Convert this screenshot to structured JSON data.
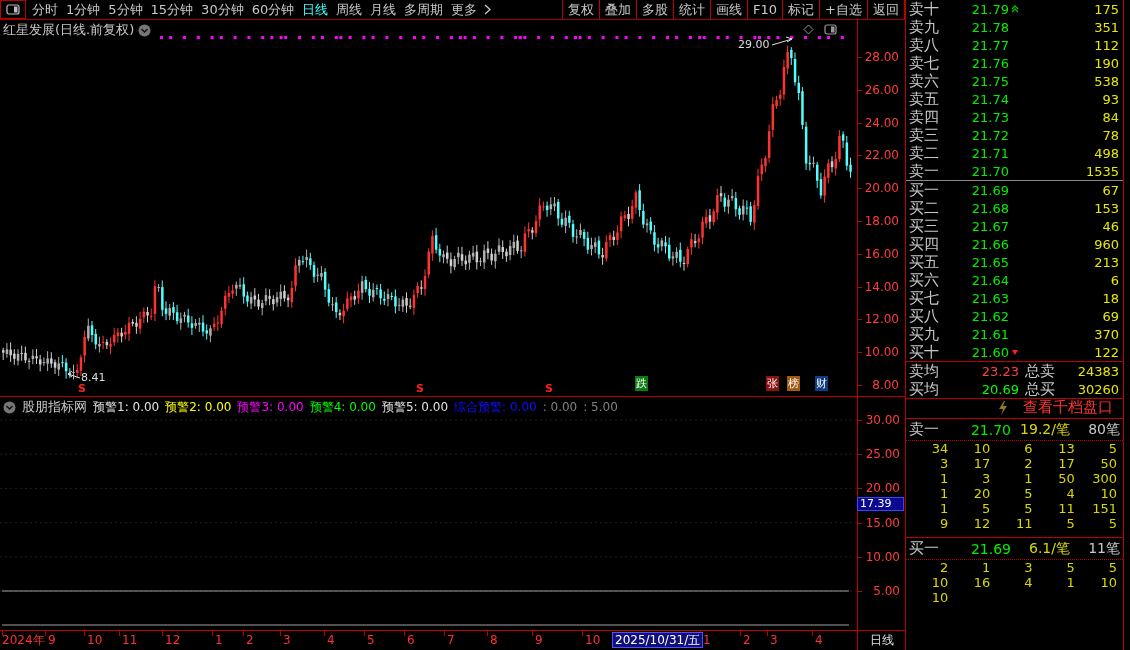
{
  "toolbar": {
    "periods": [
      {
        "label": "分时",
        "selected": false
      },
      {
        "label": "1分钟",
        "selected": false
      },
      {
        "label": "5分钟",
        "selected": false
      },
      {
        "label": "15分钟",
        "selected": false
      },
      {
        "label": "30分钟",
        "selected": false
      },
      {
        "label": "60分钟",
        "selected": false
      },
      {
        "label": "日线",
        "selected": true
      },
      {
        "label": "周线",
        "selected": false
      },
      {
        "label": "月线",
        "selected": false
      },
      {
        "label": "多周期",
        "selected": false
      },
      {
        "label": "更多",
        "selected": false
      }
    ],
    "buttons": [
      "复权",
      "叠加",
      "多股",
      "统计",
      "画线",
      "F10",
      "标记",
      "+自选",
      "返回"
    ]
  },
  "chart": {
    "title": "红星发展(日线.前复权)",
    "y_ticks": [
      "28.00",
      "26.00",
      "24.00",
      "22.00",
      "20.00",
      "18.00",
      "16.00",
      "14.00",
      "12.00",
      "10.00",
      "8.00"
    ],
    "high_label": "29.00",
    "low_label": "8.41",
    "signals": [
      {
        "text": "S"
      },
      {
        "text": "S"
      },
      {
        "text": "S"
      }
    ],
    "badges": [
      {
        "text": "跌",
        "color": "#0c7a10"
      },
      {
        "text": "张",
        "color": "#8c1212"
      },
      {
        "text": "榜",
        "color": "#a05a12"
      },
      {
        "text": "财",
        "color": "#123c80"
      }
    ]
  },
  "indicator": {
    "name": "股朋指标网",
    "values": [
      {
        "label": "预警1: 0.00",
        "color": "#e0e0e0"
      },
      {
        "label": "预警2: 0.00",
        "color": "#ffff00"
      },
      {
        "label": "预警3: 0.00",
        "color": "#ff00ff"
      },
      {
        "label": "预警4: 0.00",
        "color": "#00ff00"
      },
      {
        "label": "预警5: 0.00",
        "color": "#e0e0e0"
      },
      {
        "label": "综合预警: 0.00",
        "color": "#1010ff"
      },
      {
        "label": ": 0.00",
        "color": "#808080"
      },
      {
        "label": ": 5.00",
        "color": "#808080"
      }
    ],
    "y_ticks": [
      "30.00",
      "25.00",
      "20.00",
      "15.00",
      "10.00",
      "5.00"
    ],
    "current_value": "17.39"
  },
  "date_axis": {
    "labels": [
      "2024年",
      "9",
      "10",
      "11",
      "12",
      "1",
      "2",
      "3",
      "4",
      "5",
      "6",
      "7",
      "8",
      "9",
      "10",
      "1",
      "2",
      "3",
      "4"
    ],
    "cursor_date": "2025/10/31/五",
    "period": "日线"
  },
  "order_book": {
    "asks": [
      {
        "label": "卖十",
        "price": "21.79",
        "volume": "175",
        "arrow_up": true
      },
      {
        "label": "卖九",
        "price": "21.78",
        "volume": "351",
        "arrow_up": false
      },
      {
        "label": "卖八",
        "price": "21.77",
        "volume": "112",
        "arrow_up": false
      },
      {
        "label": "卖七",
        "price": "21.76",
        "volume": "190",
        "arrow_up": false
      },
      {
        "label": "卖六",
        "price": "21.75",
        "volume": "538",
        "arrow_up": false
      },
      {
        "label": "卖五",
        "price": "21.74",
        "volume": "93",
        "arrow_up": false
      },
      {
        "label": "卖四",
        "price": "21.73",
        "volume": "84",
        "arrow_up": false
      },
      {
        "label": "卖三",
        "price": "21.72",
        "volume": "78",
        "arrow_up": false
      },
      {
        "label": "卖二",
        "price": "21.71",
        "volume": "498",
        "arrow_up": false
      },
      {
        "label": "卖一",
        "price": "21.70",
        "volume": "1535",
        "arrow_up": false
      }
    ],
    "bids": [
      {
        "label": "买一",
        "price": "21.69",
        "volume": "67",
        "arrow_down": false
      },
      {
        "label": "买二",
        "price": "21.68",
        "volume": "153",
        "arrow_down": false
      },
      {
        "label": "买三",
        "price": "21.67",
        "volume": "46",
        "arrow_down": false
      },
      {
        "label": "买四",
        "price": "21.66",
        "volume": "960",
        "arrow_down": false
      },
      {
        "label": "买五",
        "price": "21.65",
        "volume": "213",
        "arrow_down": false
      },
      {
        "label": "买六",
        "price": "21.64",
        "volume": "6",
        "arrow_down": false
      },
      {
        "label": "买七",
        "price": "21.63",
        "volume": "18",
        "arrow_down": false
      },
      {
        "label": "买八",
        "price": "21.62",
        "volume": "69",
        "arrow_down": false
      },
      {
        "label": "买九",
        "price": "21.61",
        "volume": "370",
        "arrow_down": false
      },
      {
        "label": "买十",
        "price": "21.60",
        "volume": "122",
        "arrow_down": true
      }
    ],
    "summary": [
      {
        "label": "卖均",
        "price": "23.23",
        "color": "#ff4040",
        "total_label": "总卖",
        "total": "24383"
      },
      {
        "label": "买均",
        "price": "20.69",
        "color": "#00ff00",
        "total_label": "总买",
        "total": "30260"
      }
    ]
  },
  "depth": {
    "link": "查看千档盘口",
    "groups": [
      {
        "label": "卖一",
        "price": "21.70",
        "avg": "19.2/笔",
        "count": "80笔",
        "rows": [
          [
            "34",
            "10",
            "6",
            "13",
            "5"
          ],
          [
            "3",
            "17",
            "2",
            "17",
            "50"
          ],
          [
            "1",
            "3",
            "1",
            "50",
            "300"
          ],
          [
            "1",
            "20",
            "5",
            "4",
            "10"
          ],
          [
            "1",
            "5",
            "5",
            "11",
            "151"
          ],
          [
            "9",
            "12",
            "11",
            "5",
            "5"
          ]
        ]
      },
      {
        "label": "买一",
        "price": "21.69",
        "avg": "6.1/笔",
        "count": "11笔",
        "rows": [
          [
            "2",
            "1",
            "3",
            "5",
            "5"
          ],
          [
            "10",
            "16",
            "4",
            "1",
            "10"
          ],
          [
            "10"
          ]
        ]
      }
    ]
  }
}
